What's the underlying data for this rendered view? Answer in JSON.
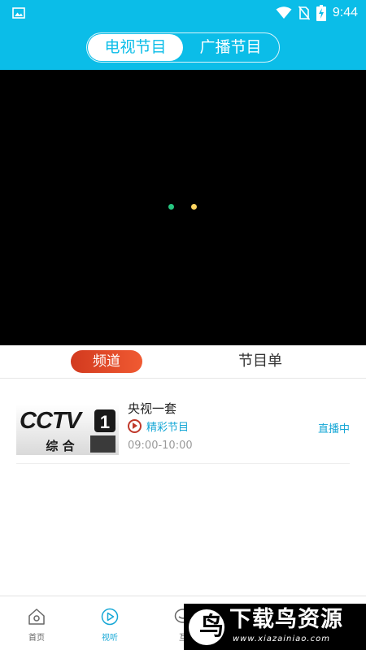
{
  "status_bar": {
    "time": "9:44",
    "icons": [
      "gallery-icon",
      "wifi-icon",
      "no-sim-icon",
      "battery-charging-icon"
    ]
  },
  "header": {
    "tabs": [
      {
        "label": "电视节目",
        "active": true
      },
      {
        "label": "广播节目",
        "active": false
      }
    ]
  },
  "player": {
    "loading_colors": [
      "#26c680",
      "#ffd561"
    ]
  },
  "sub_tabs": {
    "channels_label": "频道",
    "schedule_label": "节目单"
  },
  "channels": [
    {
      "logo_text": "CCTV",
      "logo_number": "1",
      "logo_subtitle": "综 合",
      "name": "央视一套",
      "program": "精彩节目",
      "time_range": "09:00-10:00",
      "status": "直播中"
    }
  ],
  "bottom_nav": {
    "items": [
      {
        "label": "首页",
        "icon": "home-icon"
      },
      {
        "label": "视听",
        "icon": "play-circle-icon"
      },
      {
        "label": "互",
        "icon": "chat-icon"
      }
    ]
  },
  "watermark": {
    "logo_char": "鸟",
    "title": "下载鸟资源",
    "url": "www.xiazainiao.com"
  },
  "colors": {
    "brand": "#0bbde8",
    "accent": "#15a7d6",
    "pill": "#e0462a",
    "player_bg": "#000000"
  }
}
